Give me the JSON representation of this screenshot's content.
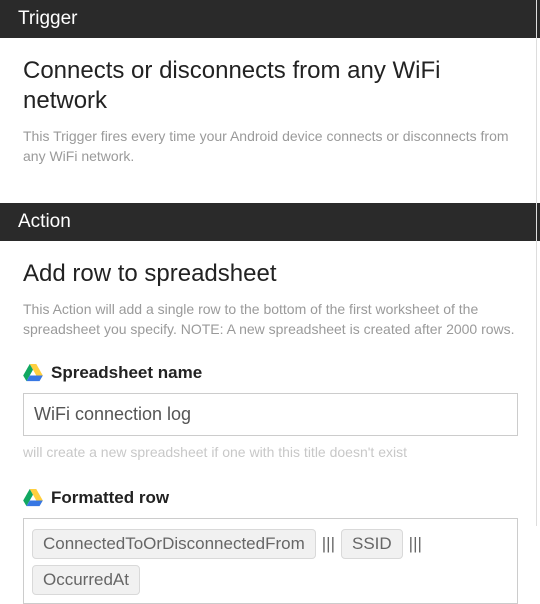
{
  "trigger": {
    "header": "Trigger",
    "title": "Connects or disconnects from any WiFi network",
    "desc": "This Trigger fires every time your Android device connects or disconnects from any WiFi network."
  },
  "action": {
    "header": "Action",
    "title": "Add row to spreadsheet",
    "desc": "This Action will add a single row to the bottom of the first worksheet of the spreadsheet you specify. NOTE: A new spreadsheet is created after 2000 rows."
  },
  "fields": {
    "spreadsheet": {
      "label": "Spreadsheet name",
      "value": "WiFi connection log",
      "hint": "will create a new spreadsheet if one with this title doesn't exist"
    },
    "formatted_row": {
      "label": "Formatted row",
      "tokens": [
        "ConnectedToOrDisconnectedFrom",
        "SSID",
        "OccurredAt"
      ],
      "sep": "|||"
    }
  }
}
